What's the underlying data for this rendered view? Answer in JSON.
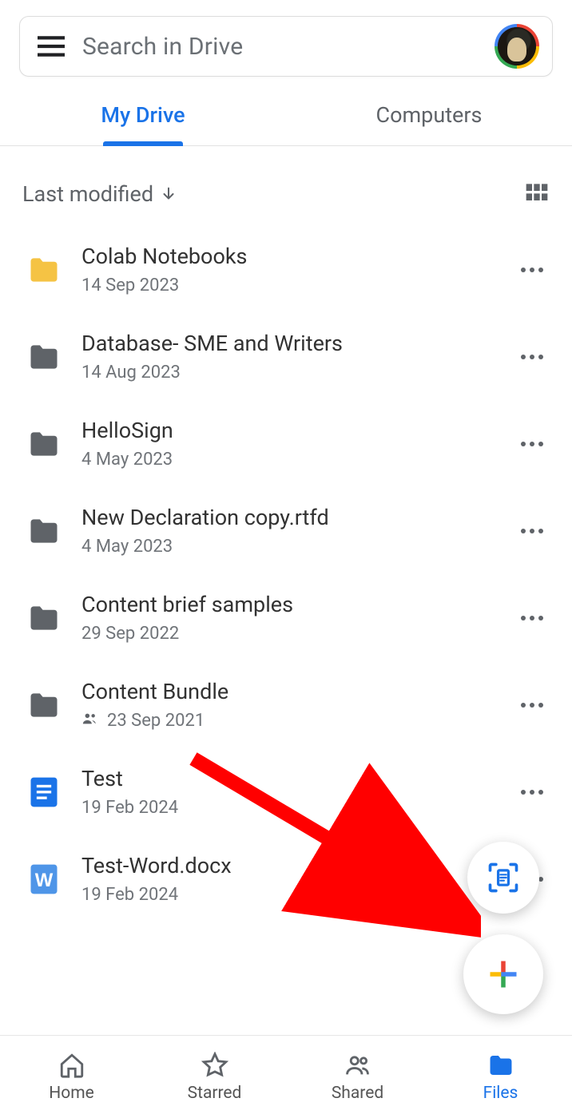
{
  "search": {
    "placeholder": "Search in Drive"
  },
  "tabs": [
    {
      "label": "My Drive",
      "active": true
    },
    {
      "label": "Computers",
      "active": false
    }
  ],
  "sort": {
    "label": "Last modified"
  },
  "files": [
    {
      "name": "Colab Notebooks",
      "date": "14 Sep 2023",
      "type": "folder-yellow",
      "shared": false
    },
    {
      "name": "Database- SME and Writers",
      "date": "14 Aug 2023",
      "type": "folder-gray",
      "shared": false
    },
    {
      "name": "HelloSign",
      "date": "4 May 2023",
      "type": "folder-gray",
      "shared": false
    },
    {
      "name": "New Declaration copy.rtfd",
      "date": "4 May 2023",
      "type": "folder-gray",
      "shared": false
    },
    {
      "name": "Content brief samples",
      "date": "29 Sep 2022",
      "type": "folder-gray",
      "shared": false
    },
    {
      "name": "Content Bundle",
      "date": "23 Sep 2021",
      "type": "folder-gray",
      "shared": true
    },
    {
      "name": "Test",
      "date": "19 Feb 2024",
      "type": "gdoc",
      "shared": false
    },
    {
      "name": "Test-Word.docx",
      "date": "19 Feb 2024",
      "type": "word",
      "shared": false
    }
  ],
  "nav": [
    {
      "label": "Home",
      "active": false
    },
    {
      "label": "Starred",
      "active": false
    },
    {
      "label": "Shared",
      "active": false
    },
    {
      "label": "Files",
      "active": true
    }
  ]
}
